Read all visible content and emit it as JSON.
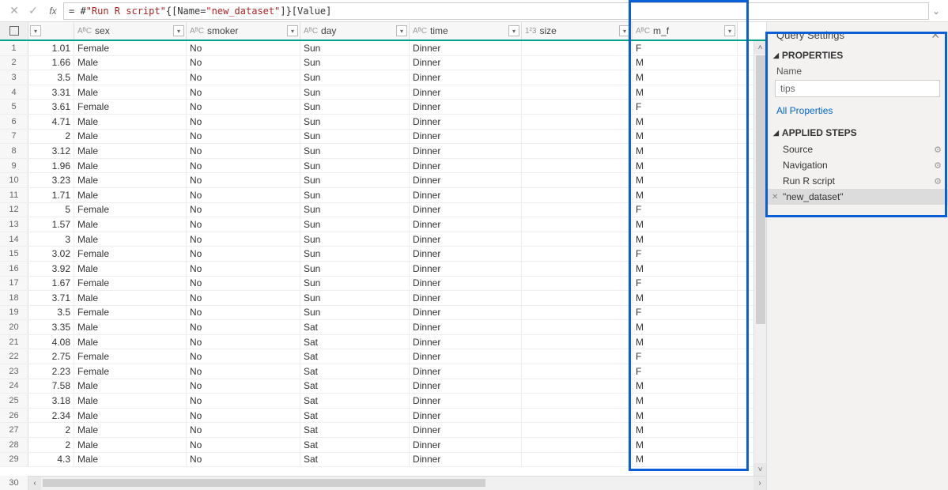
{
  "formula": {
    "prefix": "= #",
    "q1": "\"Run R script\"",
    "mid": "{[Name=",
    "q2": "\"new_dataset\"",
    "suffix": "]}[Value]"
  },
  "columns": {
    "sex": "sex",
    "smoker": "smoker",
    "day": "day",
    "time": "time",
    "size": "size",
    "mf": "m_f"
  },
  "type_abc": "AᴮC",
  "type_123": "1²3",
  "rows": [
    {
      "n": 1,
      "tip": "1.01",
      "sex": "Female",
      "smoker": "No",
      "day": "Sun",
      "time": "Dinner",
      "size": "",
      "mf": "F"
    },
    {
      "n": 2,
      "tip": "1.66",
      "sex": "Male",
      "smoker": "No",
      "day": "Sun",
      "time": "Dinner",
      "size": "",
      "mf": "M"
    },
    {
      "n": 3,
      "tip": "3.5",
      "sex": "Male",
      "smoker": "No",
      "day": "Sun",
      "time": "Dinner",
      "size": "",
      "mf": "M"
    },
    {
      "n": 4,
      "tip": "3.31",
      "sex": "Male",
      "smoker": "No",
      "day": "Sun",
      "time": "Dinner",
      "size": "",
      "mf": "M"
    },
    {
      "n": 5,
      "tip": "3.61",
      "sex": "Female",
      "smoker": "No",
      "day": "Sun",
      "time": "Dinner",
      "size": "",
      "mf": "F"
    },
    {
      "n": 6,
      "tip": "4.71",
      "sex": "Male",
      "smoker": "No",
      "day": "Sun",
      "time": "Dinner",
      "size": "",
      "mf": "M"
    },
    {
      "n": 7,
      "tip": "2",
      "sex": "Male",
      "smoker": "No",
      "day": "Sun",
      "time": "Dinner",
      "size": "",
      "mf": "M"
    },
    {
      "n": 8,
      "tip": "3.12",
      "sex": "Male",
      "smoker": "No",
      "day": "Sun",
      "time": "Dinner",
      "size": "",
      "mf": "M"
    },
    {
      "n": 9,
      "tip": "1.96",
      "sex": "Male",
      "smoker": "No",
      "day": "Sun",
      "time": "Dinner",
      "size": "",
      "mf": "M"
    },
    {
      "n": 10,
      "tip": "3.23",
      "sex": "Male",
      "smoker": "No",
      "day": "Sun",
      "time": "Dinner",
      "size": "",
      "mf": "M"
    },
    {
      "n": 11,
      "tip": "1.71",
      "sex": "Male",
      "smoker": "No",
      "day": "Sun",
      "time": "Dinner",
      "size": "",
      "mf": "M"
    },
    {
      "n": 12,
      "tip": "5",
      "sex": "Female",
      "smoker": "No",
      "day": "Sun",
      "time": "Dinner",
      "size": "",
      "mf": "F"
    },
    {
      "n": 13,
      "tip": "1.57",
      "sex": "Male",
      "smoker": "No",
      "day": "Sun",
      "time": "Dinner",
      "size": "",
      "mf": "M"
    },
    {
      "n": 14,
      "tip": "3",
      "sex": "Male",
      "smoker": "No",
      "day": "Sun",
      "time": "Dinner",
      "size": "",
      "mf": "M"
    },
    {
      "n": 15,
      "tip": "3.02",
      "sex": "Female",
      "smoker": "No",
      "day": "Sun",
      "time": "Dinner",
      "size": "",
      "mf": "F"
    },
    {
      "n": 16,
      "tip": "3.92",
      "sex": "Male",
      "smoker": "No",
      "day": "Sun",
      "time": "Dinner",
      "size": "",
      "mf": "M"
    },
    {
      "n": 17,
      "tip": "1.67",
      "sex": "Female",
      "smoker": "No",
      "day": "Sun",
      "time": "Dinner",
      "size": "",
      "mf": "F"
    },
    {
      "n": 18,
      "tip": "3.71",
      "sex": "Male",
      "smoker": "No",
      "day": "Sun",
      "time": "Dinner",
      "size": "",
      "mf": "M"
    },
    {
      "n": 19,
      "tip": "3.5",
      "sex": "Female",
      "smoker": "No",
      "day": "Sun",
      "time": "Dinner",
      "size": "",
      "mf": "F"
    },
    {
      "n": 20,
      "tip": "3.35",
      "sex": "Male",
      "smoker": "No",
      "day": "Sat",
      "time": "Dinner",
      "size": "",
      "mf": "M"
    },
    {
      "n": 21,
      "tip": "4.08",
      "sex": "Male",
      "smoker": "No",
      "day": "Sat",
      "time": "Dinner",
      "size": "",
      "mf": "M"
    },
    {
      "n": 22,
      "tip": "2.75",
      "sex": "Female",
      "smoker": "No",
      "day": "Sat",
      "time": "Dinner",
      "size": "",
      "mf": "F"
    },
    {
      "n": 23,
      "tip": "2.23",
      "sex": "Female",
      "smoker": "No",
      "day": "Sat",
      "time": "Dinner",
      "size": "",
      "mf": "F"
    },
    {
      "n": 24,
      "tip": "7.58",
      "sex": "Male",
      "smoker": "No",
      "day": "Sat",
      "time": "Dinner",
      "size": "",
      "mf": "M"
    },
    {
      "n": 25,
      "tip": "3.18",
      "sex": "Male",
      "smoker": "No",
      "day": "Sat",
      "time": "Dinner",
      "size": "",
      "mf": "M"
    },
    {
      "n": 26,
      "tip": "2.34",
      "sex": "Male",
      "smoker": "No",
      "day": "Sat",
      "time": "Dinner",
      "size": "",
      "mf": "M"
    },
    {
      "n": 27,
      "tip": "2",
      "sex": "Male",
      "smoker": "No",
      "day": "Sat",
      "time": "Dinner",
      "size": "",
      "mf": "M"
    },
    {
      "n": 28,
      "tip": "2",
      "sex": "Male",
      "smoker": "No",
      "day": "Sat",
      "time": "Dinner",
      "size": "",
      "mf": "M"
    },
    {
      "n": 29,
      "tip": "4.3",
      "sex": "Male",
      "smoker": "No",
      "day": "Sat",
      "time": "Dinner",
      "size": "",
      "mf": "M"
    },
    {
      "n": 30,
      "tip": "",
      "sex": "",
      "smoker": "",
      "day": "",
      "time": "",
      "size": "",
      "mf": ""
    }
  ],
  "sidepanel": {
    "title": "Query Settings",
    "properties": "PROPERTIES",
    "name_label": "Name",
    "name_value": "tips",
    "all_props": "All Properties",
    "applied": "APPLIED STEPS",
    "steps": [
      {
        "label": "Source",
        "gear": true
      },
      {
        "label": "Navigation",
        "gear": true
      },
      {
        "label": "Run R script",
        "gear": true
      },
      {
        "label": "\"new_dataset\"",
        "gear": false,
        "active": true
      }
    ]
  }
}
